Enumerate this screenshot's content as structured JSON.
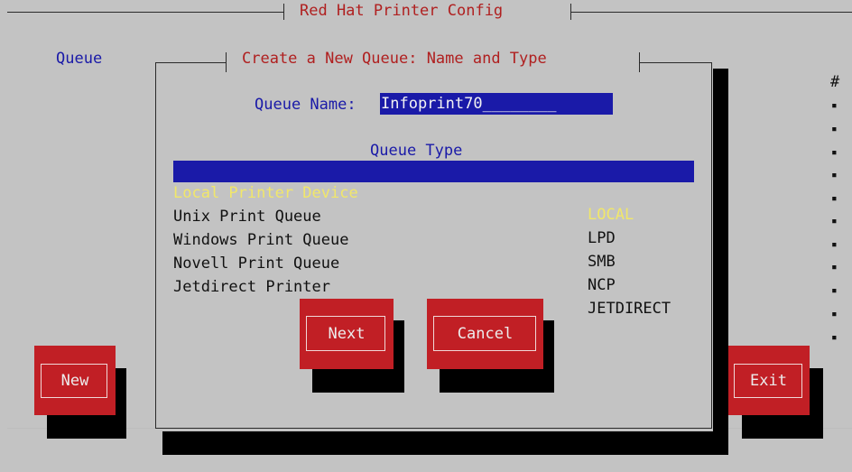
{
  "app": {
    "title": "Red Hat Printer Config"
  },
  "main": {
    "column_queue_label": "Queue",
    "column_hash_label": "#",
    "bullets": [
      "▪",
      "▪",
      "▪",
      "▪",
      "▪",
      "▪",
      "▪",
      "▪",
      "▪",
      "▪",
      "▪"
    ],
    "new_button": "New",
    "exit_button": "Exit"
  },
  "dialog": {
    "title": "Create a New Queue: Name and Type",
    "queue_name_label": "Queue Name:",
    "queue_name_value": "Infoprint70________",
    "queue_type_label": "Queue Type",
    "queue_types": [
      {
        "name": "Local Printer Device",
        "code": "LOCAL",
        "selected": true
      },
      {
        "name": "Unix Print Queue",
        "code": "LPD",
        "selected": false
      },
      {
        "name": "Windows Print Queue",
        "code": "SMB",
        "selected": false
      },
      {
        "name": "Novell Print Queue",
        "code": "NCP",
        "selected": false
      },
      {
        "name": "Jetdirect Printer",
        "code": "JETDIRECT",
        "selected": false
      }
    ],
    "next_button": "Next",
    "cancel_button": "Cancel"
  },
  "colors": {
    "background": "#c3c3c3",
    "button_red": "#c11f25",
    "selection_blue": "#1a1aa8",
    "selection_text": "#f1e76a",
    "title_red": "#b02020"
  }
}
